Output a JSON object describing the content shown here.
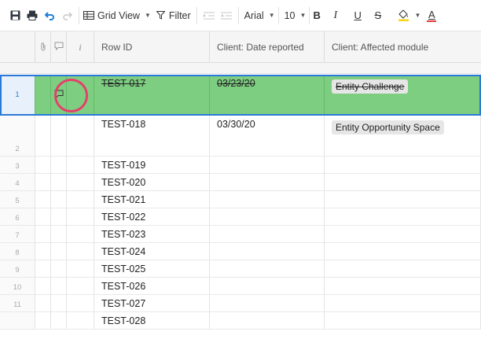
{
  "toolbar": {
    "grid_view_label": "Grid View",
    "filter_label": "Filter",
    "font_family": "Arial",
    "font_size": "10",
    "bold_label": "B",
    "italic_label": "I",
    "underline_label": "U",
    "strike_label": "S",
    "text_color_label": "A"
  },
  "columns": {
    "info_label": "i",
    "row_id": "Row ID",
    "date_reported": "Client: Date reported",
    "affected_module": "Client: Affected module"
  },
  "rows": [
    {
      "num": "1",
      "id": "TEST-017",
      "date": "03/23/20",
      "module": "Entity Challenge"
    },
    {
      "num": "2",
      "id": "TEST-018",
      "date": "03/30/20",
      "module": "Entity Opportunity Space"
    },
    {
      "num": "3",
      "id": "TEST-019"
    },
    {
      "num": "4",
      "id": "TEST-020"
    },
    {
      "num": "5",
      "id": "TEST-021"
    },
    {
      "num": "6",
      "id": "TEST-022"
    },
    {
      "num": "7",
      "id": "TEST-023"
    },
    {
      "num": "8",
      "id": "TEST-024"
    },
    {
      "num": "9",
      "id": "TEST-025"
    },
    {
      "num": "10",
      "id": "TEST-026"
    },
    {
      "num": "11",
      "id": "TEST-027"
    },
    {
      "num": "",
      "id": "TEST-028"
    }
  ],
  "colors": {
    "selected_row": "#7dce81",
    "selection_border": "#2b79d7",
    "highlight_circle": "#e4406a"
  }
}
